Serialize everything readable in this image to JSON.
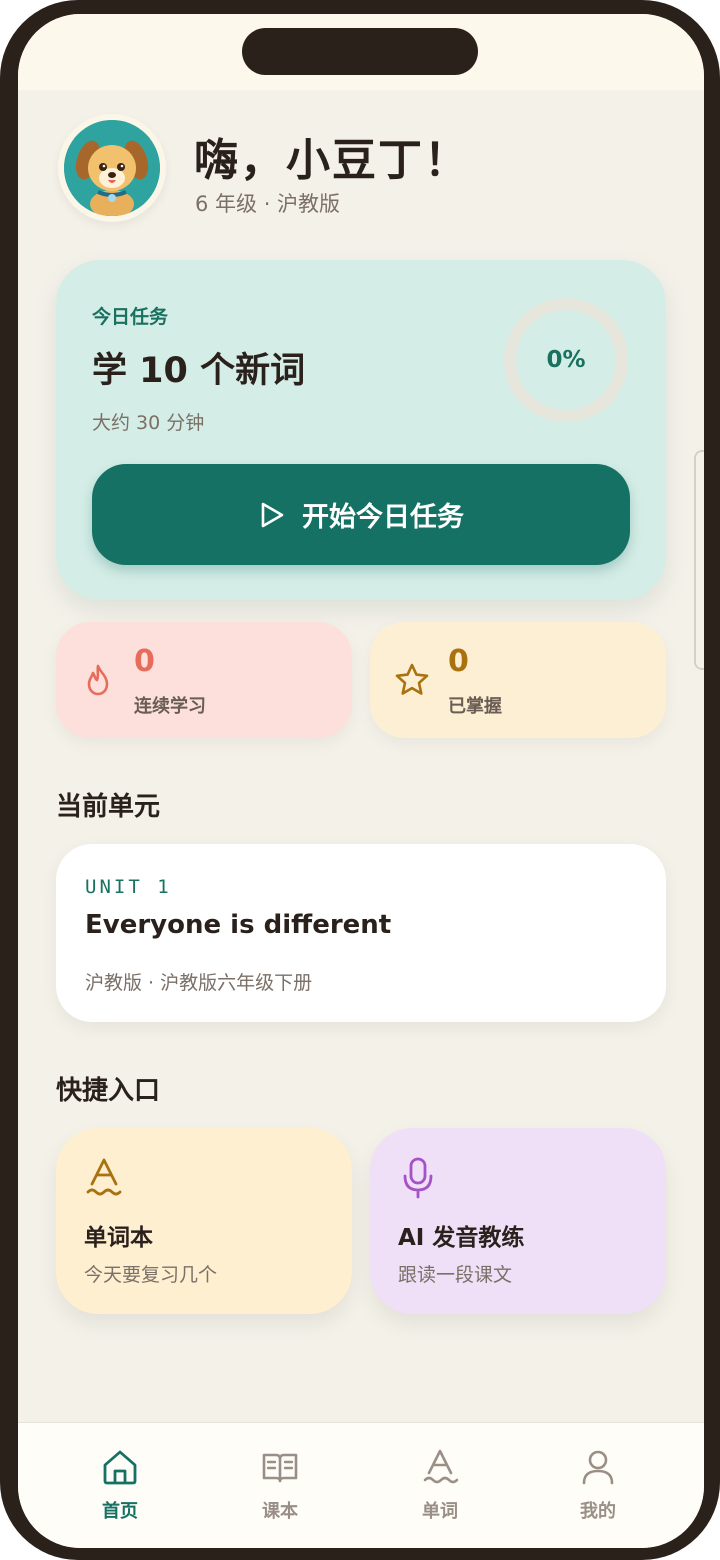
{
  "header": {
    "greeting": "嗨，小豆丁！",
    "subtitle": "6 年级 · 沪教版"
  },
  "task": {
    "label": "今日任务",
    "title": "学 10 个新词",
    "time": "大约 30 分钟",
    "progress_text": "0%",
    "progress": 0,
    "start_label": "开始今日任务"
  },
  "stats": {
    "streak": {
      "value": "0",
      "label": "连续学习",
      "icon": "flame-icon"
    },
    "mastered": {
      "value": "0",
      "label": "已掌握",
      "icon": "star-icon"
    }
  },
  "current_unit": {
    "section_title": "当前单元",
    "tag": "UNIT 1",
    "title": "Everyone is different",
    "subtitle": "沪教版 · 沪教版六年级下册"
  },
  "quick": {
    "section_title": "快捷入口",
    "items": [
      {
        "title": "单词本",
        "subtitle": "今天要复习几个",
        "icon": "letter-a-icon"
      },
      {
        "title": "AI 发音教练",
        "subtitle": "跟读一段课文",
        "icon": "microphone-icon"
      }
    ]
  },
  "tabs": [
    {
      "label": "首页",
      "icon": "home-icon",
      "active": true
    },
    {
      "label": "课本",
      "icon": "book-icon",
      "active": false
    },
    {
      "label": "单词",
      "icon": "letter-a-icon",
      "active": false
    },
    {
      "label": "我的",
      "icon": "user-icon",
      "active": false
    }
  ],
  "colors": {
    "primary": "#157163",
    "background": "#f4f1e9",
    "task_card": "#d5ede7",
    "streak_card": "#fde0dc",
    "mastered_card": "#fdefd4",
    "words_card": "#fdefd0",
    "coach_card": "#efe0f7"
  }
}
